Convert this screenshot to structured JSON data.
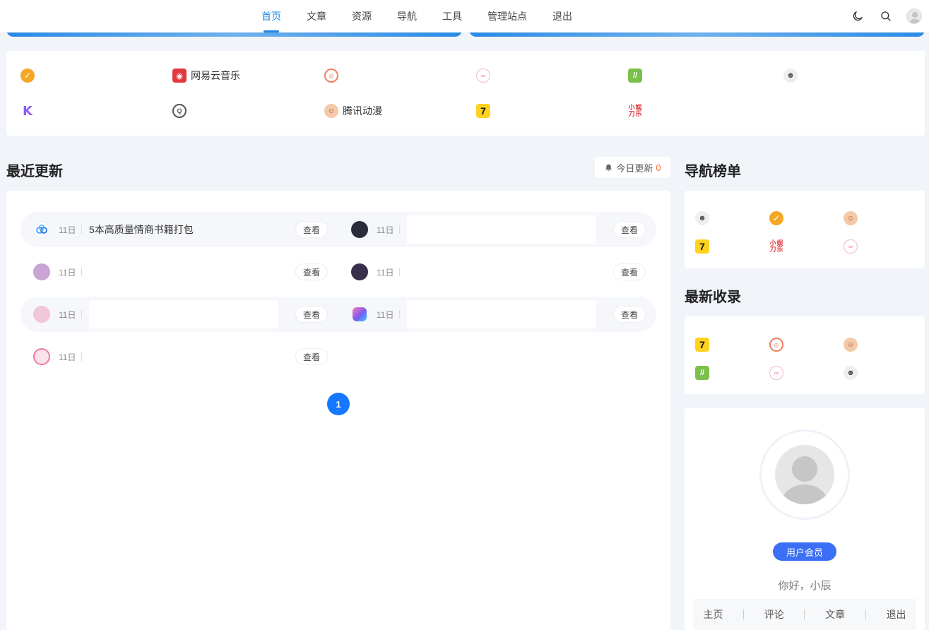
{
  "nav": {
    "items": [
      "首页",
      "文章",
      "资源",
      "导航",
      "工具",
      "管理站点",
      "退出"
    ],
    "active_index": 0,
    "accent": "#1e88e5",
    "tools": [
      "moon-icon",
      "search-icon",
      "user-avatar"
    ]
  },
  "links": {
    "row1": [
      {
        "icon": "verified-icon",
        "label": ""
      },
      {
        "icon": "netease-music-icon",
        "label": "网易云音乐"
      },
      {
        "icon": "target-icon",
        "label": ""
      },
      {
        "icon": "pig-icon",
        "label": ""
      },
      {
        "icon": "leaf-icon",
        "label": ""
      },
      {
        "icon": "man-icon",
        "label": ""
      }
    ],
    "row2": [
      {
        "icon": "k-logo-icon",
        "label": ""
      },
      {
        "icon": "q-logo-icon",
        "label": ""
      },
      {
        "icon": "monkey-icon",
        "label": "腾讯动漫"
      },
      {
        "icon": "seven-icon",
        "label": ""
      },
      {
        "icon": "xiaodao-icon",
        "label": ""
      }
    ]
  },
  "recent": {
    "title": "最近更新",
    "today_label": "今日更新",
    "today_count": "0",
    "view_label": "查看",
    "updates": [
      {
        "date": "11日",
        "title": "5本高质量情商书籍打包",
        "avatar_color": "#4aa3ff"
      },
      {
        "date": "11日",
        "title": "",
        "avatar_color": "#2b2b3a"
      },
      {
        "date": "11日",
        "title": "",
        "avatar_color": "#c9a5d6"
      },
      {
        "date": "11日",
        "title": "",
        "avatar_color": "#3a2f4a"
      },
      {
        "date": "11日",
        "title": "",
        "avatar_color": "#f0c6d8"
      },
      {
        "date": "11日",
        "title": "",
        "avatar_color": "#7a5cf0"
      },
      {
        "date": "11日",
        "title": "",
        "avatar_color": "#f07aa0"
      }
    ],
    "page": "1",
    "page_color": "#1677ff"
  },
  "nav_rank": {
    "title": "导航榜单",
    "icons": [
      "man-icon",
      "verified-icon",
      "monkey-icon",
      "seven-icon",
      "xiaodao-icon",
      "pig-icon"
    ]
  },
  "latest": {
    "title": "最新收录",
    "icons": [
      "seven-icon",
      "target-icon",
      "monkey-icon",
      "leaf-icon",
      "pig-icon",
      "man-icon"
    ]
  },
  "user": {
    "member_label": "用户会员",
    "member_color": "#3b6ff5",
    "greeting": "你好，小辰",
    "links": [
      "主页",
      "评论",
      "文章",
      "退出"
    ]
  },
  "glyphs": {
    "verified": "✓",
    "netease": "◉",
    "target": "◎",
    "pig": "∞",
    "leaf": "//",
    "man": "☻",
    "k": "K",
    "q": "Q",
    "monkey": "☺",
    "seven": "7",
    "xd1": "小刀",
    "xd2": "娱乐"
  }
}
